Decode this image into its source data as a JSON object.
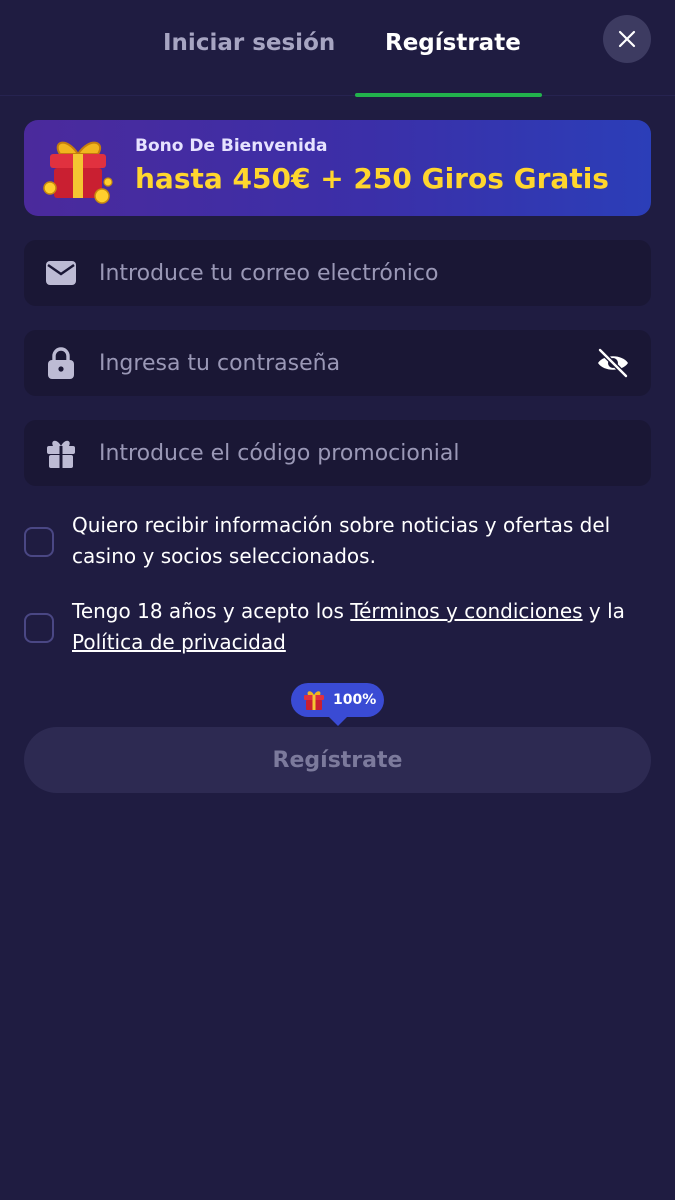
{
  "tabs": {
    "login_label": "Iniciar sesión",
    "register_label": "Regístrate",
    "active": "register"
  },
  "banner": {
    "subtitle": "Bono De Bienvenida",
    "title": "hasta 450€ + 250 Giros Gratis",
    "icon": "gift-box-icon"
  },
  "form": {
    "email": {
      "placeholder": "Introduce tu correo electrónico",
      "value": "",
      "icon": "envelope-icon"
    },
    "password": {
      "placeholder": "Ingresa tu contraseña",
      "value": "",
      "icon": "lock-icon",
      "toggle_icon": "eye-slash-icon"
    },
    "promo": {
      "placeholder": "Introduce el código promocionial",
      "value": "",
      "icon": "gift-icon"
    }
  },
  "checkboxes": {
    "news": {
      "checked": false,
      "text": "Quiero recibir información sobre noticias y ofertas del casino y socios seleccionados."
    },
    "terms": {
      "checked": false,
      "prefix": "Tengo 18 años y acepto los ",
      "terms_link": "Términos y condiciones",
      "middle": " y la ",
      "privacy_link": "Política de privacidad"
    }
  },
  "progress": {
    "value": "100%",
    "icon": "gift-icon"
  },
  "submit": {
    "label": "Regístrate"
  },
  "colors": {
    "background": "#1f1c41",
    "field_background": "#1a1735",
    "active_tab_underline": "#22b24c",
    "banner_title": "#ffd62e",
    "progress_bubble": "#3a4bd4",
    "submit_background": "#2d2a52"
  }
}
